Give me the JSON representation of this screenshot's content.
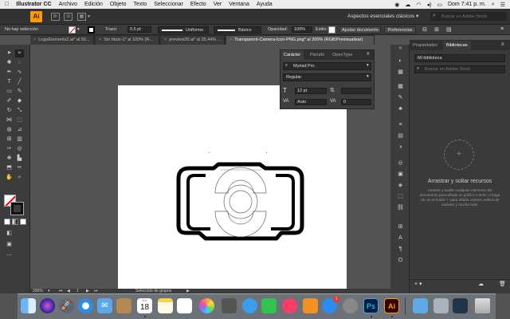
{
  "menubar": {
    "app_name": "Illustrator CC",
    "items": [
      "Archivo",
      "Edición",
      "Objeto",
      "Texto",
      "Seleccionar",
      "Efecto",
      "Ver",
      "Ventana",
      "Ayuda"
    ],
    "clock": "Dom 7:41 p. m."
  },
  "appbar": {
    "logo": "Ai",
    "workspace": "Aspectos esenciales clásicos",
    "search_placeholder": "Buscar en Adobe Stock"
  },
  "controlbar": {
    "selection_label": "No hay selección",
    "stroke_label": "Trazo:",
    "stroke_value": "0,5 pt",
    "profile": "Uniforme",
    "brush": "Básico",
    "opacity_label": "Opacidad:",
    "opacity_value": "100%",
    "style_label": "Estilo:",
    "doc_setup_button": "Ajustar documento",
    "prefs_button": "Preferencias"
  },
  "tabs": [
    {
      "label": "LogoElements2.ai* al 50...",
      "active": false
    },
    {
      "label": "Sin título-1* al 100% (R...",
      "active": false
    },
    {
      "label": "preview25.ai* al 35,44% ...",
      "active": false
    },
    {
      "label": "Transparent-Camera-Icon-PNG.png* al 200% (RGB/Previsualizar)",
      "active": true
    }
  ],
  "character_panel": {
    "tabs": [
      "Carácter",
      "Párrafo",
      "OpenType"
    ],
    "font_family": "Myriad Pro",
    "font_style": "Regular",
    "font_size": "12 pt",
    "leading": "",
    "kerning": "Auto",
    "tracking": "0"
  },
  "status": {
    "zoom": "200%",
    "page": "1",
    "tool_status": "Selección de grupos"
  },
  "libraries": {
    "tabs": [
      "Propiedades",
      "Bibliotecas"
    ],
    "library_name": "Mi biblioteca",
    "search_placeholder": "Buscar en Adobe Stock",
    "empty_title": "Arrastrar y soltar recursos",
    "empty_desc": "Arrastre y suelte cualquier elemento del documento para añadir un gráfico o texto, o haga clic en el botón '+' para añadir colores, estilos de carácter y mucho más."
  },
  "dock": {
    "calendar_month": "JUL",
    "calendar_day": "18",
    "appstore_badge": "1",
    "ps_label": "Ps",
    "ai_label": "Ai"
  },
  "colors": {
    "ai_orange": "#ff9a00",
    "ps_blue": "#31a8ff",
    "ui_dark": "#323232"
  }
}
